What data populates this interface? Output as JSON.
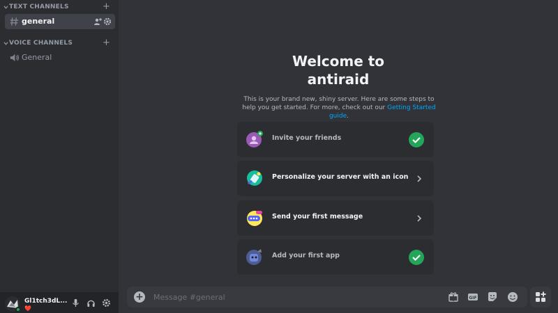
{
  "sidebar": {
    "text_category": "TEXT CHANNELS",
    "voice_category": "VOICE CHANNELS",
    "text_channels": [
      {
        "name": "general",
        "active": true
      }
    ],
    "voice_channels": [
      {
        "name": "General"
      }
    ]
  },
  "user": {
    "name": "Gl1tch3dL...",
    "status_emoji": "❤️"
  },
  "welcome": {
    "title_line1": "Welcome to",
    "title_line2": "antiraid",
    "subtitle": "This is your brand new, shiny server. Here are some steps to help you get started. For more, check out our ",
    "link": "Getting Started guide",
    "subtitle_end": "."
  },
  "cards": [
    {
      "label": "Invite your friends",
      "done": true,
      "icon": "invite-icon"
    },
    {
      "label": "Personalize your server with an icon",
      "done": false,
      "icon": "personalize-icon"
    },
    {
      "label": "Send your first message",
      "done": false,
      "icon": "message-icon"
    },
    {
      "label": "Add your first app",
      "done": true,
      "icon": "app-icon"
    }
  ],
  "composer": {
    "placeholder": "Message #general"
  },
  "colors": {
    "accent_green": "#23a55a",
    "link_blue": "#00a8fc",
    "bg_main": "#313338",
    "bg_sidebar": "#2b2d31"
  }
}
